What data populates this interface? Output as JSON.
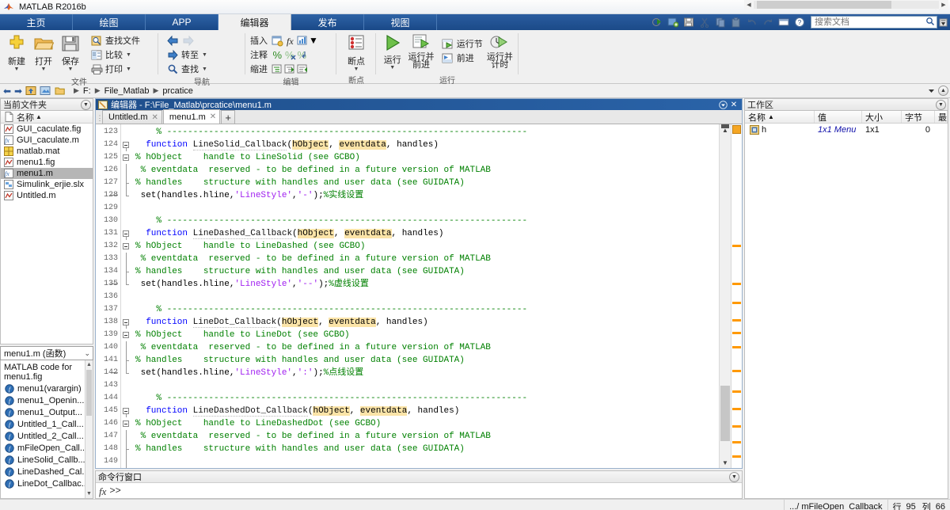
{
  "window": {
    "title": "MATLAB R2016b",
    "app_icon": "matlab-logo-icon",
    "minimize": "–",
    "maximize": "□",
    "close": "✕"
  },
  "ribbon_tabs": [
    {
      "label": "主页",
      "name": "tab-home",
      "active": false
    },
    {
      "label": "绘图",
      "name": "tab-plots",
      "active": false
    },
    {
      "label": "APP",
      "name": "tab-apps",
      "active": false
    },
    {
      "label": "编辑器",
      "name": "tab-editor",
      "active": true
    },
    {
      "label": "发布",
      "name": "tab-publish",
      "active": false
    },
    {
      "label": "视图",
      "name": "tab-view",
      "active": false
    }
  ],
  "quick_access": {
    "icons": [
      "run-section-icon",
      "save-workspace-icon",
      "save-icon",
      "cut-icon",
      "copy-icon",
      "paste-icon",
      "undo-icon",
      "redo-icon",
      "layout-icon",
      "help-icon"
    ],
    "search_placeholder": "搜索文档",
    "search_value": "",
    "search_icon": "magnifier-icon",
    "collapse_icon": "collapse-ribbon-icon"
  },
  "ribbon_groups": [
    {
      "name": "group-file",
      "label": "文件",
      "big_buttons": [
        {
          "label": "新建",
          "icon": "new-file-icon",
          "dropdown": true
        },
        {
          "label": "打开",
          "icon": "open-folder-icon",
          "dropdown": true
        },
        {
          "label": "保存",
          "icon": "save-disk-icon",
          "dropdown": true
        }
      ],
      "small_buttons": [
        {
          "label": "查找文件",
          "icon": "find-files-icon",
          "dropdown": false
        },
        {
          "label": "比较",
          "icon": "compare-icon",
          "dropdown": true
        },
        {
          "label": "打印",
          "icon": "print-icon",
          "dropdown": true
        }
      ]
    },
    {
      "name": "group-navigate",
      "label": "导航",
      "small_buttons": [
        {
          "label": "",
          "icon": "back-arrow-icon",
          "dropdown": false
        },
        {
          "label": "",
          "icon": "forward-arrow-icon",
          "dropdown": false
        },
        {
          "label": "转至",
          "icon": "goto-icon",
          "dropdown": true
        },
        {
          "label": "查找",
          "icon": "find-icon",
          "dropdown": true
        }
      ]
    },
    {
      "name": "group-edit",
      "label": "编辑",
      "rows": [
        {
          "label": "插入",
          "icons": [
            "insert-block-icon",
            "insert-function-icon",
            "insert-figure-icon"
          ],
          "dropdown": true
        },
        {
          "label": "注释",
          "icons": [
            "comment-icon",
            "uncomment-icon",
            "wrap-comment-icon"
          ],
          "dropdown": false
        },
        {
          "label": "缩进",
          "icons": [
            "smart-indent-icon",
            "indent-right-icon",
            "indent-left-icon"
          ],
          "dropdown": false
        }
      ]
    },
    {
      "name": "group-breakpoints",
      "label": "断点",
      "big_buttons": [
        {
          "label": "断点",
          "icon": "breakpoint-icon",
          "dropdown": true
        }
      ]
    },
    {
      "name": "group-run",
      "label": "运行",
      "big_buttons": [
        {
          "label": "运行",
          "icon": "run-icon",
          "dropdown": true
        },
        {
          "label": "运行并\n前进",
          "icon": "run-advance-icon",
          "dropdown": false
        },
        {
          "label": "运行并\n计时",
          "icon": "run-time-icon",
          "dropdown": false
        }
      ],
      "small_buttons": [
        {
          "label": "运行节",
          "icon": "run-section-icon",
          "dropdown": false
        },
        {
          "label": "前进",
          "icon": "advance-icon",
          "dropdown": false
        }
      ]
    }
  ],
  "pathbar": {
    "back_icon": "nav-back-icon",
    "forward_icon": "nav-forward-icon",
    "up_icon": "nav-up-icon",
    "browse_icon": "nav-browse-icon",
    "folder_icon": "folder-icon",
    "crumbs": [
      "F:",
      "File_Matlab",
      "prcatice"
    ],
    "dropdown_icon": "chevron-down-icon",
    "help_icon": "help-circle-icon"
  },
  "current_folder": {
    "title": "当前文件夹",
    "column_header": "名称",
    "sort_indicator": "▲",
    "files": [
      {
        "name": "GUI_caculate.fig",
        "icon": "fig-file-icon",
        "selected": false
      },
      {
        "name": "GUI_caculate.m",
        "icon": "m-file-icon",
        "selected": false
      },
      {
        "name": "matlab.mat",
        "icon": "mat-file-icon",
        "selected": false
      },
      {
        "name": "menu1.fig",
        "icon": "fig-file-icon",
        "selected": false
      },
      {
        "name": "menu1.m",
        "icon": "m-file-icon",
        "selected": true
      },
      {
        "name": "Simulink_erjie.slx",
        "icon": "slx-file-icon",
        "selected": false
      },
      {
        "name": "Untitled.m",
        "icon": "fig-file-icon",
        "selected": false
      }
    ]
  },
  "details_panel": {
    "selector_value": "menu1.m  (函数)",
    "description": "MATLAB code for menu1.fig",
    "functions": [
      "menu1(varargin)",
      "menu1_Openin...",
      "menu1_Output...",
      "Untitled_1_Call...",
      "Untitled_2_Call...",
      "mFileOpen_Call...",
      "LineSolid_Callb...",
      "LineDashed_Cal...",
      "LineDot_Callbac..."
    ],
    "function_icon": "function-icon"
  },
  "editor": {
    "window_icon": "editor-icon",
    "title": "编辑器 - F:\\File_Matlab\\prcatice\\menu1.m",
    "undock_icon": "undock-icon",
    "close_icon": "close-icon",
    "tabs": [
      {
        "label": "Untitled.m",
        "active": false,
        "close": "✕"
      },
      {
        "label": "menu1.m",
        "active": true,
        "close": "✕"
      }
    ],
    "new_tab_label": "+",
    "first_line_number": 123,
    "lines": [
      {
        "n": 123,
        "dash": false,
        "fold": "",
        "tokens": [
          {
            "t": "    % ---------------------------------------------------------------------",
            "c": "cm"
          }
        ]
      },
      {
        "n": 124,
        "dash": false,
        "fold": "open",
        "tokens": [
          {
            "t": "  ",
            "c": ""
          },
          {
            "t": "function",
            "c": "kw"
          },
          {
            "t": " ",
            "c": ""
          },
          {
            "t": "LineSolid_Callback",
            "c": "fn"
          },
          {
            "t": "(",
            "c": ""
          },
          {
            "t": "hObject",
            "c": "hl"
          },
          {
            "t": ", ",
            "c": ""
          },
          {
            "t": "eventdata",
            "c": "hl"
          },
          {
            "t": ", handles)",
            "c": ""
          }
        ]
      },
      {
        "n": 125,
        "dash": false,
        "fold": "open2",
        "tokens": [
          {
            "t": "% hObject    handle to LineSolid (see GCBO)",
            "c": "cm"
          }
        ]
      },
      {
        "n": 126,
        "dash": false,
        "fold": "bar",
        "tokens": [
          {
            "t": " % eventdata  reserved - to be defined in a future version of MATLAB",
            "c": "cm"
          }
        ]
      },
      {
        "n": 127,
        "dash": false,
        "fold": "barend",
        "tokens": [
          {
            "t": "% handles    structure with handles and user data (see GUIDATA)",
            "c": "cm"
          }
        ]
      },
      {
        "n": 128,
        "dash": true,
        "fold": "close",
        "tokens": [
          {
            "t": " set(handles.hline,",
            "c": ""
          },
          {
            "t": "'LineStyle'",
            "c": "str"
          },
          {
            "t": ",",
            "c": ""
          },
          {
            "t": "'-'",
            "c": "str"
          },
          {
            "t": ");",
            "c": ""
          },
          {
            "t": "%实线设置",
            "c": "cm"
          }
        ]
      },
      {
        "n": 129,
        "dash": false,
        "fold": "",
        "tokens": [
          {
            "t": "",
            "c": ""
          }
        ]
      },
      {
        "n": 130,
        "dash": false,
        "fold": "",
        "tokens": [
          {
            "t": "    % ---------------------------------------------------------------------",
            "c": "cm"
          }
        ]
      },
      {
        "n": 131,
        "dash": false,
        "fold": "open",
        "tokens": [
          {
            "t": "  ",
            "c": ""
          },
          {
            "t": "function",
            "c": "kw"
          },
          {
            "t": " ",
            "c": ""
          },
          {
            "t": "LineDashed_Callback",
            "c": "fn"
          },
          {
            "t": "(",
            "c": ""
          },
          {
            "t": "hObject",
            "c": "hl"
          },
          {
            "t": ", ",
            "c": ""
          },
          {
            "t": "eventdata",
            "c": "hl"
          },
          {
            "t": ", handles)",
            "c": ""
          }
        ]
      },
      {
        "n": 132,
        "dash": false,
        "fold": "open2",
        "tokens": [
          {
            "t": "% hObject    handle to LineDashed (see GCBO)",
            "c": "cm"
          }
        ]
      },
      {
        "n": 133,
        "dash": false,
        "fold": "bar",
        "tokens": [
          {
            "t": " % eventdata  reserved - to be defined in a future version of MATLAB",
            "c": "cm"
          }
        ]
      },
      {
        "n": 134,
        "dash": false,
        "fold": "barend",
        "tokens": [
          {
            "t": "% handles    structure with handles and user data (see GUIDATA)",
            "c": "cm"
          }
        ]
      },
      {
        "n": 135,
        "dash": true,
        "fold": "close",
        "tokens": [
          {
            "t": " set(handles.hline,",
            "c": ""
          },
          {
            "t": "'LineStyle'",
            "c": "str"
          },
          {
            "t": ",",
            "c": ""
          },
          {
            "t": "'--'",
            "c": "str"
          },
          {
            "t": ");",
            "c": ""
          },
          {
            "t": "%虚线设置",
            "c": "cm"
          }
        ]
      },
      {
        "n": 136,
        "dash": false,
        "fold": "",
        "tokens": [
          {
            "t": "",
            "c": ""
          }
        ]
      },
      {
        "n": 137,
        "dash": false,
        "fold": "",
        "tokens": [
          {
            "t": "    % ---------------------------------------------------------------------",
            "c": "cm"
          }
        ]
      },
      {
        "n": 138,
        "dash": false,
        "fold": "open",
        "tokens": [
          {
            "t": "  ",
            "c": ""
          },
          {
            "t": "function",
            "c": "kw"
          },
          {
            "t": " ",
            "c": ""
          },
          {
            "t": "LineDot_Callback",
            "c": "fn"
          },
          {
            "t": "(",
            "c": ""
          },
          {
            "t": "hObject",
            "c": "hl"
          },
          {
            "t": ", ",
            "c": ""
          },
          {
            "t": "eventdata",
            "c": "hl"
          },
          {
            "t": ", handles)",
            "c": ""
          }
        ]
      },
      {
        "n": 139,
        "dash": false,
        "fold": "open2",
        "tokens": [
          {
            "t": "% hObject    handle to LineDot (see GCBO)",
            "c": "cm"
          }
        ]
      },
      {
        "n": 140,
        "dash": false,
        "fold": "bar",
        "tokens": [
          {
            "t": " % eventdata  reserved - to be defined in a future version of MATLAB",
            "c": "cm"
          }
        ]
      },
      {
        "n": 141,
        "dash": false,
        "fold": "barend",
        "tokens": [
          {
            "t": "% handles    structure with handles and user data (see GUIDATA)",
            "c": "cm"
          }
        ]
      },
      {
        "n": 142,
        "dash": true,
        "fold": "close",
        "tokens": [
          {
            "t": " set(handles.hline,",
            "c": ""
          },
          {
            "t": "'LineStyle'",
            "c": "str"
          },
          {
            "t": ",",
            "c": ""
          },
          {
            "t": "':'",
            "c": "str"
          },
          {
            "t": ");",
            "c": ""
          },
          {
            "t": "%点线设置",
            "c": "cm"
          }
        ]
      },
      {
        "n": 143,
        "dash": false,
        "fold": "",
        "tokens": [
          {
            "t": "",
            "c": ""
          }
        ]
      },
      {
        "n": 144,
        "dash": false,
        "fold": "",
        "tokens": [
          {
            "t": "    % ---------------------------------------------------------------------",
            "c": "cm"
          }
        ]
      },
      {
        "n": 145,
        "dash": false,
        "fold": "open",
        "tokens": [
          {
            "t": "  ",
            "c": ""
          },
          {
            "t": "function",
            "c": "kw"
          },
          {
            "t": " ",
            "c": ""
          },
          {
            "t": "LineDashedDot_Callback",
            "c": "fn"
          },
          {
            "t": "(",
            "c": ""
          },
          {
            "t": "hObject",
            "c": "hl"
          },
          {
            "t": ", ",
            "c": ""
          },
          {
            "t": "eventdata",
            "c": "hl"
          },
          {
            "t": ", handles)",
            "c": ""
          }
        ]
      },
      {
        "n": 146,
        "dash": false,
        "fold": "open2",
        "tokens": [
          {
            "t": "% hObject    handle to LineDashedDot (see GCBO)",
            "c": "cm"
          }
        ]
      },
      {
        "n": 147,
        "dash": false,
        "fold": "bar",
        "tokens": [
          {
            "t": " % eventdata  reserved - to be defined in a future version of MATLAB",
            "c": "cm"
          }
        ]
      },
      {
        "n": 148,
        "dash": false,
        "fold": "barend",
        "tokens": [
          {
            "t": "% handles    structure with handles and user data (see GUIDATA)",
            "c": "cm"
          }
        ]
      },
      {
        "n": 149,
        "dash": false,
        "fold": "bar",
        "tokens": [
          {
            "t": "",
            "c": ""
          }
        ]
      }
    ]
  },
  "command_window": {
    "title": "命令行窗口",
    "fx_label": "fx",
    "prompt": ">>",
    "dropdown_icon": "chevron-down-icon"
  },
  "workspace": {
    "title": "工作区",
    "dropdown_icon": "chevron-down-icon",
    "columns": [
      "名称",
      "值",
      "大小",
      "字节",
      "最"
    ],
    "sort_indicator": "▲",
    "rows": [
      {
        "icon": "variable-icon",
        "name": "h",
        "value": "1x1 Menu",
        "size": "1x1",
        "bytes": "0",
        "extra": ""
      }
    ]
  },
  "status_bar": {
    "function_path": ".../ mFileOpen_Callback",
    "line_label": "行",
    "line_value": "95",
    "col_label": "列",
    "col_value": "66"
  },
  "colors": {
    "ribbon_blue": "#1d4e8f",
    "tab_active_bg": "#f0f0f0",
    "keyword": "#0000ff",
    "comment": "#008000",
    "string": "#a020f0",
    "highlight": "#fbe4a8",
    "analyzer_orange": "#ff9900",
    "selection_gray": "#b6b6b6"
  }
}
